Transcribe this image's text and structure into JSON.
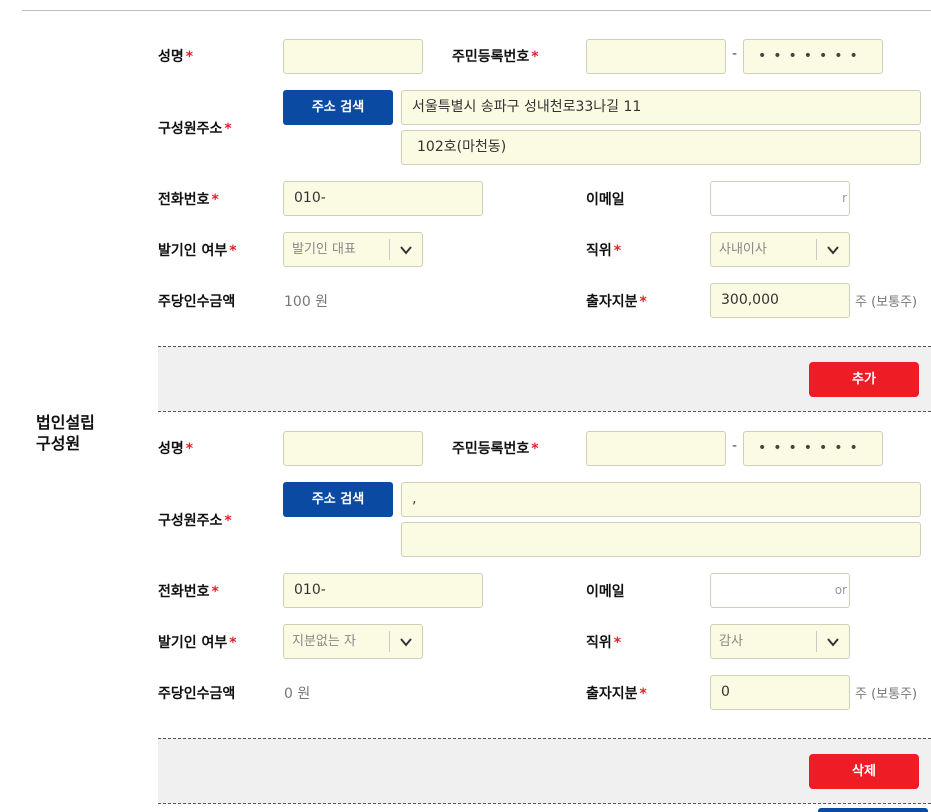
{
  "section": {
    "title_line1": "법인설립",
    "title_line2": "구성원"
  },
  "labels": {
    "name": "성명",
    "rrn": "주민등록번호",
    "address": "구성원주소",
    "phone": "전화번호",
    "email": "이메일",
    "promoter": "발기인 여부",
    "position": "직위",
    "amount": "주당인수금액",
    "share": "출자지분",
    "required_mark": "*",
    "rrn_dash": "-",
    "address_search": "주소 검색",
    "share_unit": "주 (보통주)"
  },
  "members": [
    {
      "name": "",
      "rrn_front": "",
      "rrn_back": "•••••••",
      "address1": "서울특별시 송파구 성내천로33나길 11",
      "address2": "102호(마천동)",
      "phone": "010-",
      "email": "",
      "email_fragment": "r",
      "promoter": "발기인 대표",
      "position": "사내이사",
      "amount": "100 원",
      "share": "300,000",
      "action": "추가"
    },
    {
      "name": "",
      "rrn_front": "",
      "rrn_back": "•••••••",
      "address1": "‚",
      "address2": "",
      "phone": "010-",
      "email": "",
      "email_fragment": "or",
      "promoter": "지분없는 자",
      "position": "감사",
      "amount": "0 원",
      "share": "0",
      "action": "삭제"
    }
  ],
  "colors": {
    "input_bg": "#fbfbe3",
    "primary_blue": "#0b4aa3",
    "danger_red": "#ee1c25",
    "required": "#e0202a"
  }
}
